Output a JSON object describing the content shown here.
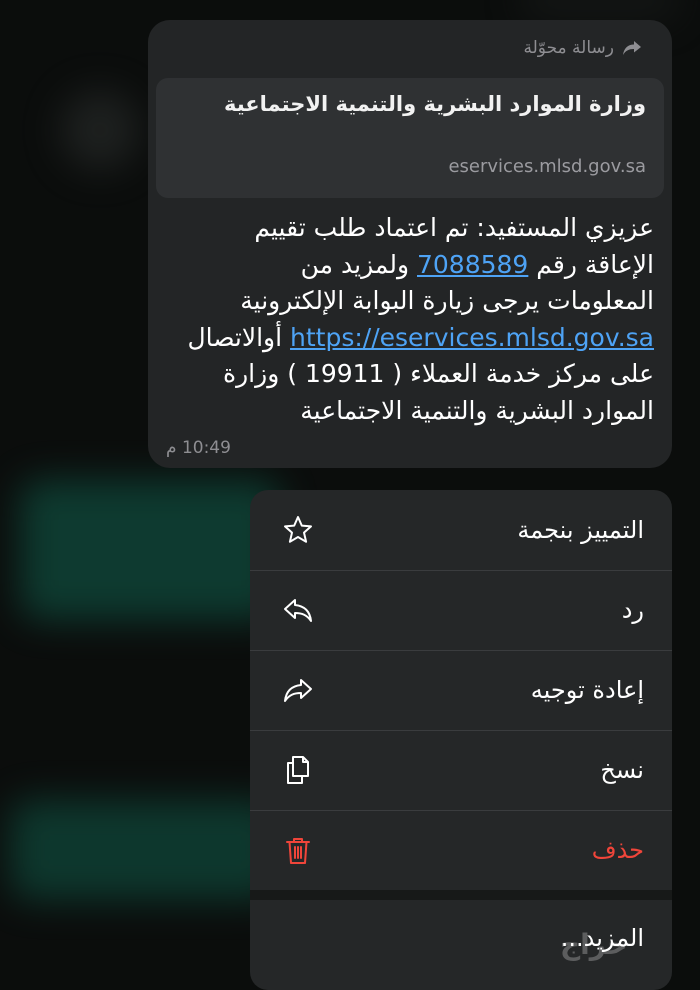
{
  "message": {
    "forwarded_label": "رسالة محوّلة",
    "preview": {
      "title": "وزارة الموارد البشرية والتنمية الاجتماعية",
      "domain": "eservices.mlsd.gov.sa"
    },
    "text_line1": "عزيزي المستفيد:  تم اعتماد  طلب تقييم",
    "text_line2_pre": "الإعاقة رقم ",
    "text_number": "7088589",
    "text_line2_post": " ولمزيد من",
    "text_line3": "المعلومات يرجى زيارة البوابة الإلكترونية",
    "text_link": "https://eservices.mlsd.gov.sa",
    "text_line4_post": " أوالاتصال",
    "text_line5": "على مركز خدمة العملاء ( 19911 ) وزارة",
    "text_line6": "الموارد البشرية والتنمية الاجتماعية",
    "time": "10:49 م"
  },
  "menu": {
    "star": "التمييز بنجمة",
    "reply": "رد",
    "forward": "إعادة توجيه",
    "copy": "نسخ",
    "delete": "حذف",
    "more": "المزيد..."
  },
  "icons": {
    "star": "star-icon",
    "reply": "reply-icon",
    "forward": "forward-icon",
    "copy": "copy-icon",
    "delete": "trash-icon"
  },
  "colors": {
    "link": "#4ea3f5",
    "danger": "#f0453a",
    "bubble": "#232526",
    "menu": "#252728"
  },
  "watermark": "حراج"
}
